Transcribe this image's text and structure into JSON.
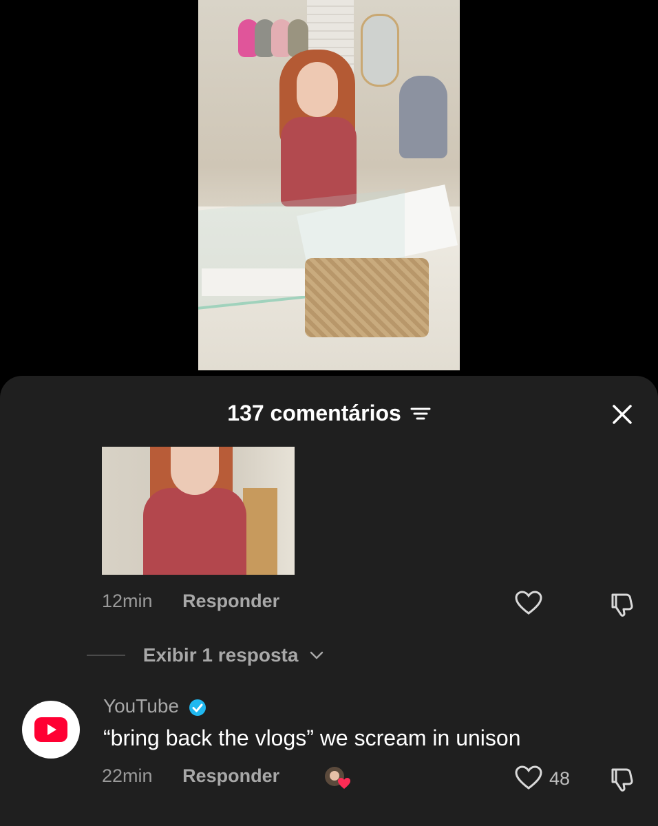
{
  "video": {
    "alt": "video-frame"
  },
  "comments_sheet": {
    "title": "137 comentários",
    "filter_icon": "filter-lines-icon",
    "close_icon": "close-icon"
  },
  "comment1": {
    "time": "12min",
    "reply_label": "Responder",
    "view_replies": "Exibir 1 resposta"
  },
  "comment2": {
    "author": "YouTube",
    "verified": true,
    "text": "“bring back the vlogs” we scream in unison",
    "time": "22min",
    "reply_label": "Responder",
    "likes": "48"
  },
  "colors": {
    "sheet_bg": "#1f1f1f",
    "youtube_red": "#ff0033",
    "verified_blue": "#20b8f0",
    "heart_pink": "#fe2c55"
  }
}
